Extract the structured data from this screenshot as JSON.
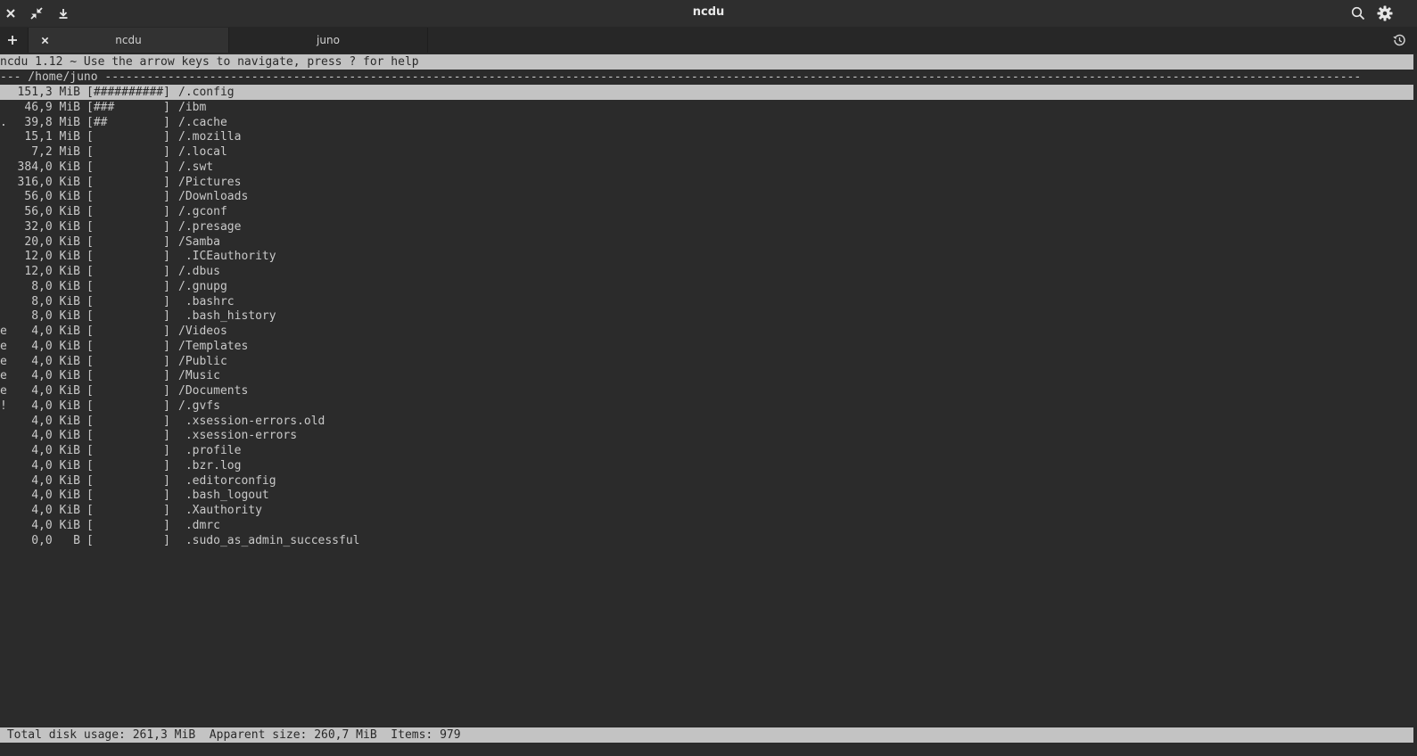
{
  "window": {
    "title": "ncdu",
    "icons": [
      "close-icon",
      "unmaximize-icon",
      "download-icon",
      "search-icon",
      "gear-icon"
    ]
  },
  "tabs": [
    {
      "label": "ncdu",
      "active": true
    },
    {
      "label": "juno",
      "active": false
    }
  ],
  "terminal": {
    "header": "ncdu 1.12 ~ Use the arrow keys to navigate, press ? for help",
    "path": "--- /home/juno ------------------------------------------------------------------------------------------------------------------------------------------------------------------------------------",
    "entries": [
      {
        "flag": "",
        "size": "151,3 MiB",
        "bar": "[##########]",
        "name": "/.config",
        "selected": true
      },
      {
        "flag": "",
        "size": "46,9 MiB",
        "bar": "[###       ]",
        "name": "/ibm"
      },
      {
        "flag": ".",
        "size": "39,8 MiB",
        "bar": "[##        ]",
        "name": "/.cache"
      },
      {
        "flag": "",
        "size": "15,1 MiB",
        "bar": "[          ]",
        "name": "/.mozilla"
      },
      {
        "flag": "",
        "size": "7,2 MiB",
        "bar": "[          ]",
        "name": "/.local"
      },
      {
        "flag": "",
        "size": "384,0 KiB",
        "bar": "[          ]",
        "name": "/.swt"
      },
      {
        "flag": "",
        "size": "316,0 KiB",
        "bar": "[          ]",
        "name": "/Pictures"
      },
      {
        "flag": "",
        "size": "56,0 KiB",
        "bar": "[          ]",
        "name": "/Downloads"
      },
      {
        "flag": "",
        "size": "56,0 KiB",
        "bar": "[          ]",
        "name": "/.gconf"
      },
      {
        "flag": "",
        "size": "32,0 KiB",
        "bar": "[          ]",
        "name": "/.presage"
      },
      {
        "flag": "",
        "size": "20,0 KiB",
        "bar": "[          ]",
        "name": "/Samba"
      },
      {
        "flag": "",
        "size": "12,0 KiB",
        "bar": "[          ]",
        "name": " .ICEauthority"
      },
      {
        "flag": "",
        "size": "12,0 KiB",
        "bar": "[          ]",
        "name": "/.dbus"
      },
      {
        "flag": "",
        "size": "8,0 KiB",
        "bar": "[          ]",
        "name": "/.gnupg"
      },
      {
        "flag": "",
        "size": "8,0 KiB",
        "bar": "[          ]",
        "name": " .bashrc"
      },
      {
        "flag": "",
        "size": "8,0 KiB",
        "bar": "[          ]",
        "name": " .bash_history"
      },
      {
        "flag": "e",
        "size": "4,0 KiB",
        "bar": "[          ]",
        "name": "/Videos"
      },
      {
        "flag": "e",
        "size": "4,0 KiB",
        "bar": "[          ]",
        "name": "/Templates"
      },
      {
        "flag": "e",
        "size": "4,0 KiB",
        "bar": "[          ]",
        "name": "/Public"
      },
      {
        "flag": "e",
        "size": "4,0 KiB",
        "bar": "[          ]",
        "name": "/Music"
      },
      {
        "flag": "e",
        "size": "4,0 KiB",
        "bar": "[          ]",
        "name": "/Documents"
      },
      {
        "flag": "!",
        "size": "4,0 KiB",
        "bar": "[          ]",
        "name": "/.gvfs"
      },
      {
        "flag": "",
        "size": "4,0 KiB",
        "bar": "[          ]",
        "name": " .xsession-errors.old"
      },
      {
        "flag": "",
        "size": "4,0 KiB",
        "bar": "[          ]",
        "name": " .xsession-errors"
      },
      {
        "flag": "",
        "size": "4,0 KiB",
        "bar": "[          ]",
        "name": " .profile"
      },
      {
        "flag": "",
        "size": "4,0 KiB",
        "bar": "[          ]",
        "name": " .bzr.log"
      },
      {
        "flag": "",
        "size": "4,0 KiB",
        "bar": "[          ]",
        "name": " .editorconfig"
      },
      {
        "flag": "",
        "size": "4,0 KiB",
        "bar": "[          ]",
        "name": " .bash_logout"
      },
      {
        "flag": "",
        "size": "4,0 KiB",
        "bar": "[          ]",
        "name": " .Xauthority"
      },
      {
        "flag": "",
        "size": "4,0 KiB",
        "bar": "[          ]",
        "name": " .dmrc"
      },
      {
        "flag": "",
        "size": "0,0   B",
        "bar": "[          ]",
        "name": " .sudo_as_admin_successful"
      }
    ],
    "status": " Total disk usage: 261,3 MiB  Apparent size: 260,7 MiB  Items: 979"
  }
}
